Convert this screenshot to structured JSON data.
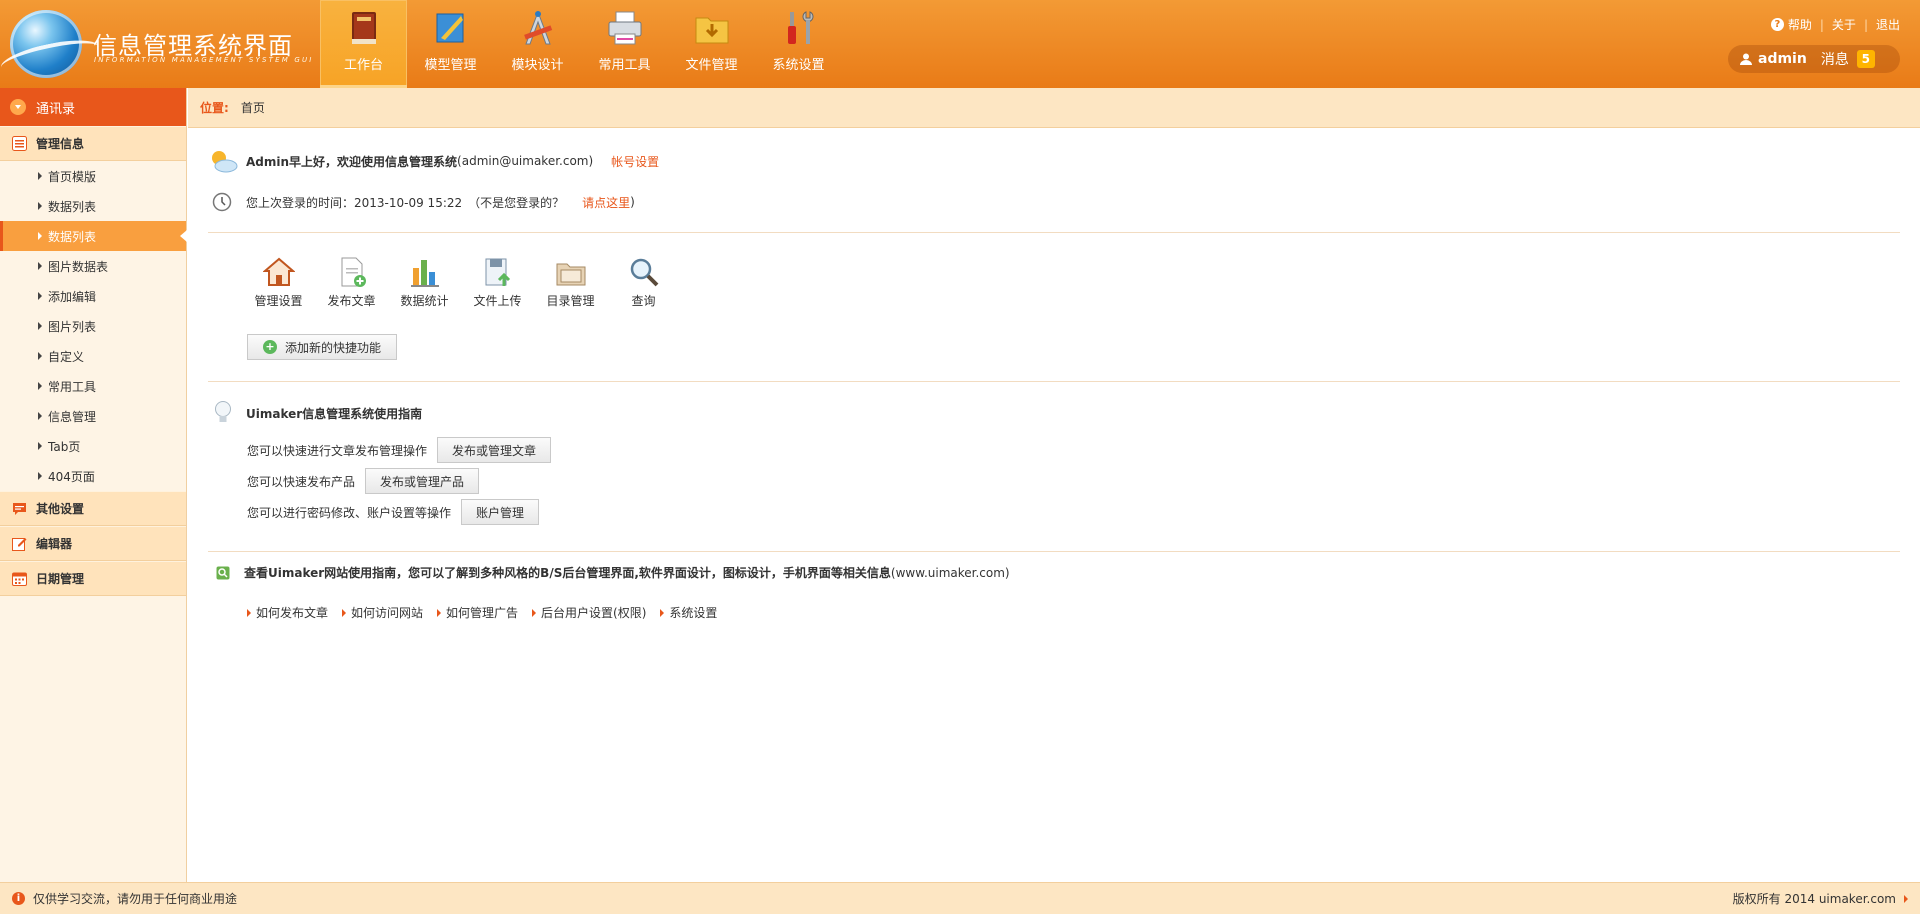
{
  "logo": {
    "title": "信息管理系统界面",
    "subtitle": "INFORMATION MANAGEMENT SYSTEM GUI"
  },
  "nav": [
    {
      "label": "工作台",
      "icon": "book-icon",
      "active": true
    },
    {
      "label": "模型管理",
      "icon": "ruler-icon",
      "active": false
    },
    {
      "label": "模块设计",
      "icon": "compass-icon",
      "active": false
    },
    {
      "label": "常用工具",
      "icon": "printer-icon",
      "active": false
    },
    {
      "label": "文件管理",
      "icon": "folder-icon",
      "active": false
    },
    {
      "label": "系统设置",
      "icon": "tools-icon",
      "active": false
    }
  ],
  "top_links": {
    "help": "帮助",
    "about": "关于",
    "logout": "退出"
  },
  "user": {
    "name": "admin",
    "msg_label": "消息",
    "msg_count": "5"
  },
  "sidebar": {
    "top_label": "通讯录",
    "group1": "管理信息",
    "items": [
      "首页模版",
      "数据列表",
      "数据列表",
      "图片数据表",
      "添加编辑",
      "图片列表",
      "自定义",
      "常用工具",
      "信息管理",
      "Tab页",
      "404页面"
    ],
    "group2": "其他设置",
    "group3": "编辑器",
    "group4": "日期管理"
  },
  "breadcrumb": {
    "label": "位置:",
    "current": "首页"
  },
  "welcome": {
    "greeting": "Admin早上好，欢迎使用信息管理系统",
    "email": "(admin@uimaker.com)",
    "account_link": "帐号设置",
    "last_login_prefix": "您上次登录的时间：2013-10-09 15:22",
    "not_you": "（不是您登录的？",
    "click_here": "请点这里",
    "close_paren": ")"
  },
  "quick": [
    {
      "label": "管理设置",
      "icon": "house-icon"
    },
    {
      "label": "发布文章",
      "icon": "document-add-icon"
    },
    {
      "label": "数据统计",
      "icon": "bar-chart-icon"
    },
    {
      "label": "文件上传",
      "icon": "upload-icon"
    },
    {
      "label": "目录管理",
      "icon": "folder-open-icon"
    },
    {
      "label": "查询",
      "icon": "magnifier-icon"
    }
  ],
  "add_quick": "添加新的快捷功能",
  "guide": {
    "title": "Uimaker信息管理系统使用指南",
    "rows": [
      {
        "text": "您可以快速进行文章发布管理操作",
        "button": "发布或管理文章"
      },
      {
        "text": "您可以快速发布产品",
        "button": "发布或管理产品"
      },
      {
        "text": "您可以进行密码修改、账户设置等操作",
        "button": "账户管理"
      }
    ]
  },
  "site": {
    "text": "查看Uimaker网站使用指南，您可以了解到多种风格的B/S后台管理界面,软件界面设计，图标设计，手机界面等相关信息",
    "url": "(www.uimaker.com)",
    "links": [
      "如何发布文章",
      "如何访问网站",
      "如何管理广告",
      "后台用户设置(权限)",
      "系统设置"
    ]
  },
  "footer": {
    "notice": "仅供学习交流，请勿用于任何商业用途",
    "copyright": "版权所有 2014 uimaker.com"
  },
  "colors": {
    "header": "#e97b17",
    "accent": "#e8571b",
    "sidebar_bg": "#fef4e5",
    "breadcrumb_bg": "#fde6c3"
  }
}
